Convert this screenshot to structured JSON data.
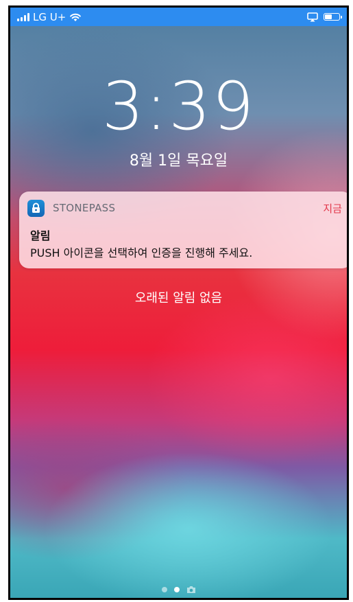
{
  "status_bar": {
    "carrier": "LG U+",
    "battery_level": 0.45
  },
  "lock_screen": {
    "time": "3:39",
    "date": "8월 1일 목요일",
    "no_older_notifications": "오래된 알림 없음"
  },
  "notification": {
    "app_name": "STONEPASS",
    "time": "지금",
    "title": "알림",
    "body": "PUSH 아이콘을 선택하여 인증을 진행해 주세요."
  },
  "page_indicator": {
    "pages": 3,
    "current": 2
  },
  "colors": {
    "status_bar_bg": "#2d8cf0",
    "notification_time": "#e2374a",
    "app_icon": "#1f8fd8"
  },
  "icons": [
    "signal-icon",
    "wifi-icon",
    "airplay-icon",
    "battery-icon",
    "lock-app-icon",
    "camera-icon"
  ]
}
